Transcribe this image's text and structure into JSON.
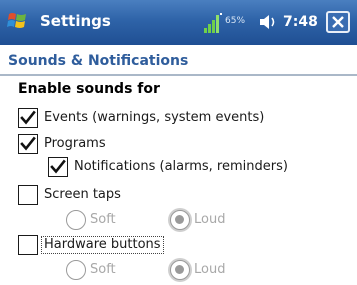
{
  "titlebar": {
    "title": "Settings",
    "battery": "65%",
    "time": "7:48",
    "icons": {
      "start": "windows-flag-icon",
      "signal": "signal-strength-icon",
      "volume": "speaker-icon",
      "close": "close-icon"
    }
  },
  "page": {
    "header": "Sounds & Notifications"
  },
  "content": {
    "section_label": "Enable sounds for",
    "events": {
      "label": "Events (warnings, system events)",
      "checked": true
    },
    "programs": {
      "label": "Programs",
      "checked": true
    },
    "notifications": {
      "label": "Notifications (alarms, reminders)",
      "checked": true
    },
    "screen_taps": {
      "label": "Screen taps",
      "checked": false,
      "options": {
        "soft": "Soft",
        "loud": "Loud"
      },
      "selected": "loud"
    },
    "hardware_buttons": {
      "label": "Hardware buttons",
      "checked": false,
      "options": {
        "soft": "Soft",
        "loud": "Loud"
      },
      "selected": "loud"
    }
  }
}
